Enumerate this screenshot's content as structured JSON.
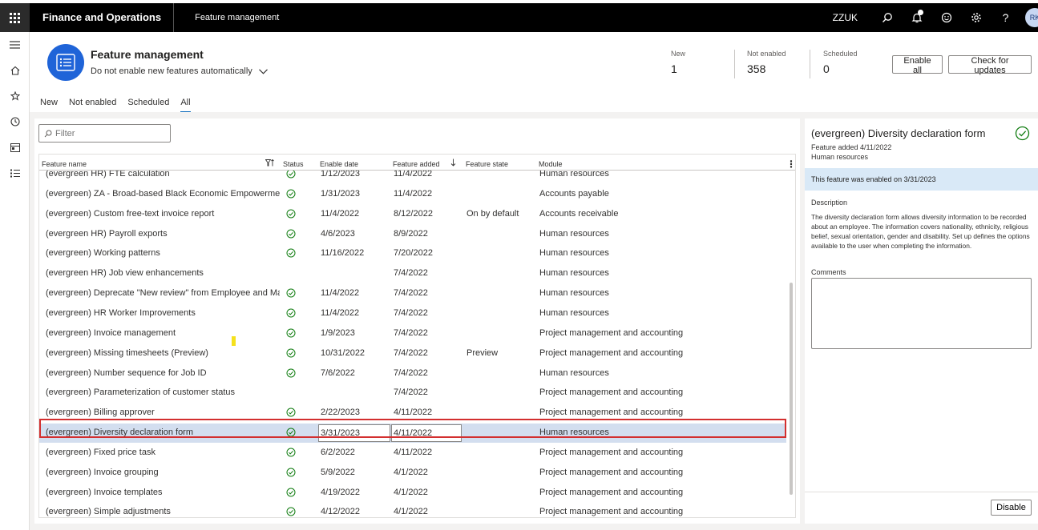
{
  "topbar": {
    "app_name": "Finance and Operations",
    "breadcrumb": "Feature management",
    "company": "ZZUK",
    "avatar_initials": "RK"
  },
  "header": {
    "title": "Feature management",
    "auto_enable_option": "Do not enable new features automatically",
    "kpis": [
      {
        "label": "New",
        "value": "1"
      },
      {
        "label": "Not enabled",
        "value": "358"
      },
      {
        "label": "Scheduled",
        "value": "0"
      }
    ],
    "enable_all_label": "Enable all",
    "check_updates_label": "Check for updates"
  },
  "tabs": [
    {
      "label": "New",
      "active": false
    },
    {
      "label": "Not enabled",
      "active": false
    },
    {
      "label": "Scheduled",
      "active": false
    },
    {
      "label": "All",
      "active": true
    }
  ],
  "filter": {
    "placeholder": "Filter"
  },
  "grid": {
    "columns": [
      "Feature name",
      "Status",
      "Enable date",
      "Feature added",
      "Feature state",
      "Module"
    ],
    "rows": [
      {
        "name": "(evergreen HR) FTE calculation",
        "enabled": true,
        "enable_date": "1/12/2023",
        "added": "11/4/2022",
        "state": "",
        "module": "Human resources"
      },
      {
        "name": "(evergreen) ZA - Broad-based Black Economic Empowermen...",
        "enabled": true,
        "enable_date": "1/31/2023",
        "added": "11/4/2022",
        "state": "",
        "module": "Accounts payable"
      },
      {
        "name": "(evergreen) Custom free-text invoice report",
        "enabled": true,
        "enable_date": "11/4/2022",
        "added": "8/12/2022",
        "state": "On by default",
        "module": "Accounts receivable"
      },
      {
        "name": "(evergreen HR) Payroll exports",
        "enabled": true,
        "enable_date": "4/6/2023",
        "added": "8/9/2022",
        "state": "",
        "module": "Human resources"
      },
      {
        "name": "(evergreen) Working patterns",
        "enabled": true,
        "enable_date": "11/16/2022",
        "added": "7/20/2022",
        "state": "",
        "module": "Human resources"
      },
      {
        "name": "(evergreen HR) Job view enhancements",
        "enabled": false,
        "enable_date": "",
        "added": "7/4/2022",
        "state": "",
        "module": "Human resources"
      },
      {
        "name": "(evergreen) Deprecate \"New review\" from Employee and Ma...",
        "enabled": true,
        "enable_date": "11/4/2022",
        "added": "7/4/2022",
        "state": "",
        "module": "Human resources"
      },
      {
        "name": "(evergreen) HR Worker Improvements",
        "enabled": true,
        "enable_date": "11/4/2022",
        "added": "7/4/2022",
        "state": "",
        "module": "Human resources"
      },
      {
        "name": "(evergreen) Invoice management",
        "enabled": true,
        "enable_date": "1/9/2023",
        "added": "7/4/2022",
        "state": "",
        "module": "Project management and accounting"
      },
      {
        "name": "(evergreen) Missing timesheets (Preview)",
        "enabled": true,
        "enable_date": "10/31/2022",
        "added": "7/4/2022",
        "state": "Preview",
        "module": "Project management and accounting"
      },
      {
        "name": "(evergreen) Number sequence for Job ID",
        "enabled": true,
        "enable_date": "7/6/2022",
        "added": "7/4/2022",
        "state": "",
        "module": "Human resources"
      },
      {
        "name": "(evergreen) Parameterization of customer status",
        "enabled": false,
        "enable_date": "",
        "added": "7/4/2022",
        "state": "",
        "module": "Project management and accounting"
      },
      {
        "name": "(evergreen) Billing approver",
        "enabled": true,
        "enable_date": "2/22/2023",
        "added": "4/11/2022",
        "state": "",
        "module": "Project management and accounting"
      },
      {
        "name": "(evergreen) Diversity declaration form",
        "enabled": true,
        "enable_date": "3/31/2023",
        "added": "4/11/2022",
        "state": "",
        "module": "Human resources",
        "selected": true
      },
      {
        "name": "(evergreen) Fixed price task",
        "enabled": true,
        "enable_date": "6/2/2022",
        "added": "4/11/2022",
        "state": "",
        "module": "Project management and accounting"
      },
      {
        "name": "(evergreen) Invoice grouping",
        "enabled": true,
        "enable_date": "5/9/2022",
        "added": "4/1/2022",
        "state": "",
        "module": "Project management and accounting"
      },
      {
        "name": "(evergreen) Invoice templates",
        "enabled": true,
        "enable_date": "4/19/2022",
        "added": "4/1/2022",
        "state": "",
        "module": "Project management and accounting"
      },
      {
        "name": "(evergreen) Simple adjustments",
        "enabled": true,
        "enable_date": "4/12/2022",
        "added": "4/1/2022",
        "state": "",
        "module": "Project management and accounting"
      }
    ]
  },
  "detail": {
    "title": "(evergreen) Diversity declaration form",
    "feature_added": "Feature added 4/11/2022",
    "module": "Human resources",
    "enabled_banner": "This feature was enabled on 3/31/2023",
    "description_label": "Description",
    "description": "The diversity declaration form allows diversity information to be recorded about an employee. The information covers nationality, ethnicity, religious belief, sexual orientation, gender and disability. Set up defines the options available to the user when completing the information.",
    "comments_label": "Comments",
    "disable_label": "Disable"
  },
  "colors": {
    "accent": "#0f6cbd",
    "check_green": "#107c10",
    "selected_row": "#d3deef",
    "selection_outline": "#d32f2f"
  }
}
